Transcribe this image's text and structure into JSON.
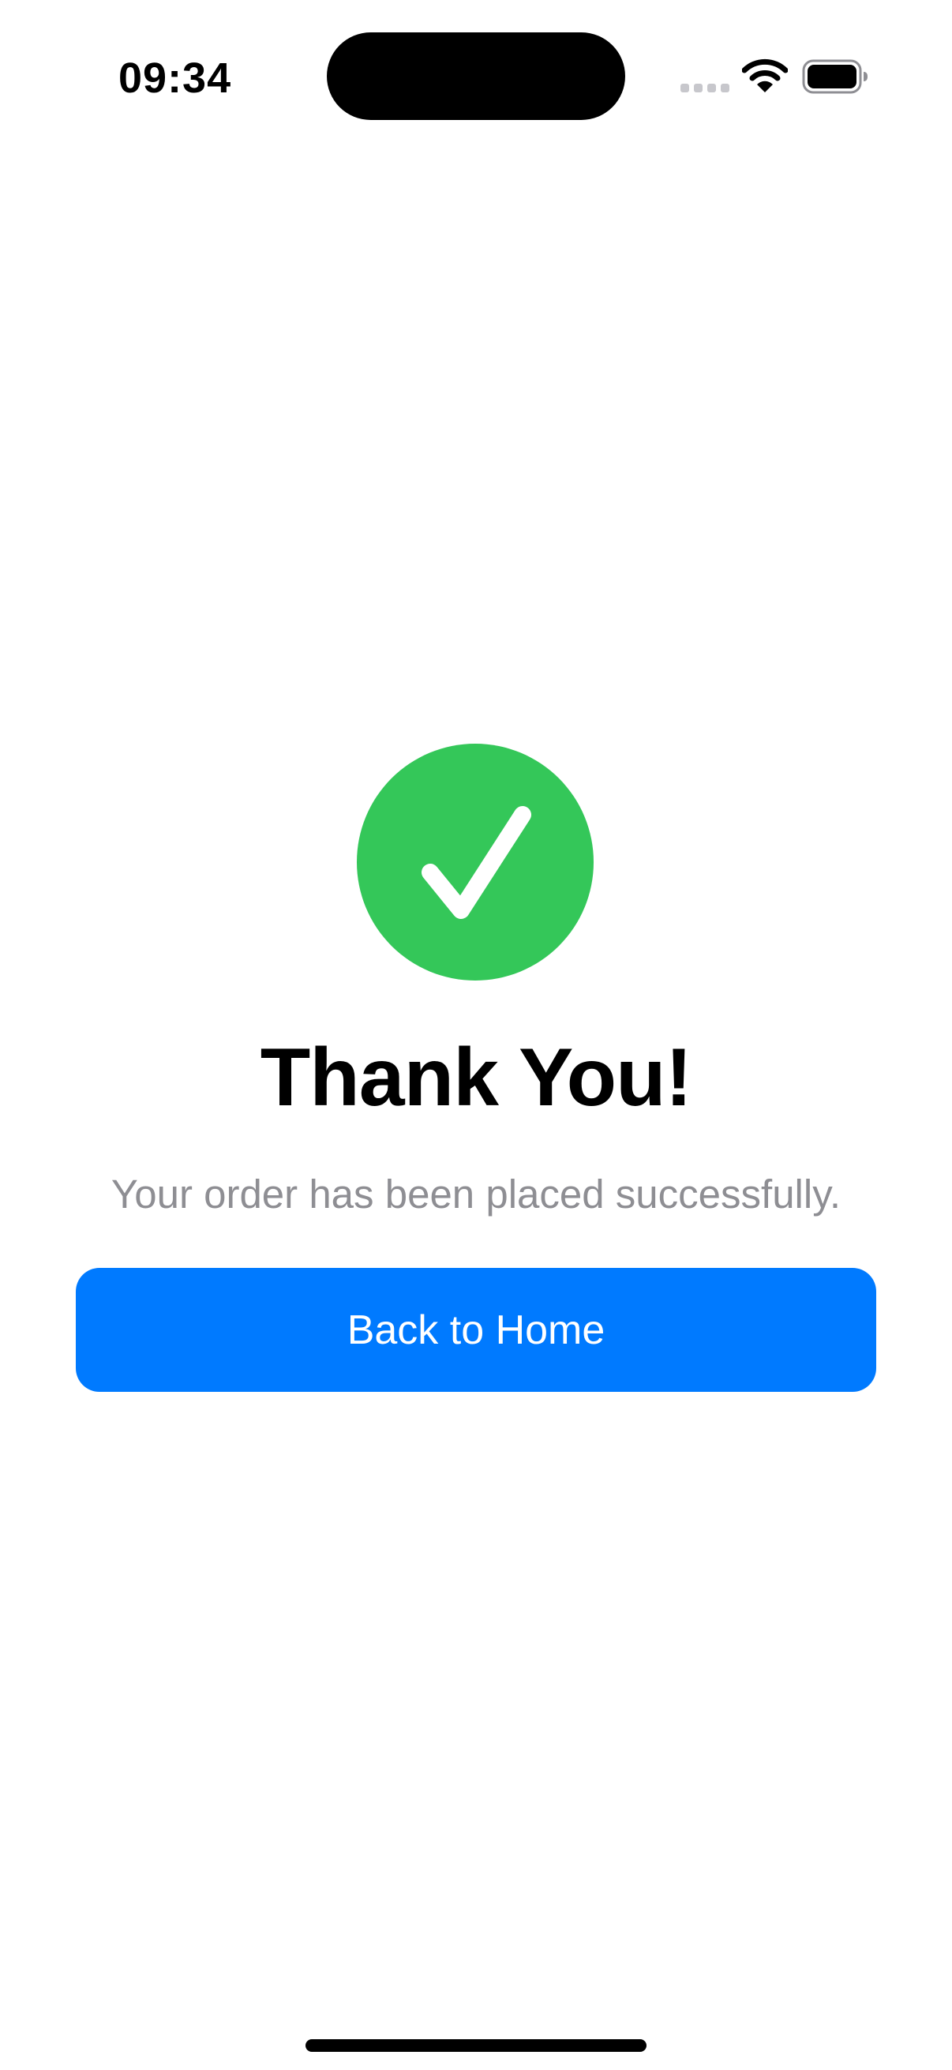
{
  "status_bar": {
    "time": "09:34",
    "icons": [
      "cellular-signal-icon",
      "wifi-icon",
      "battery-icon"
    ]
  },
  "confirmation": {
    "icon": "checkmark-circle-icon",
    "icon_color": "#34c759",
    "title": "Thank You!",
    "message": "Your order has been placed successfully."
  },
  "actions": {
    "back_home_label": "Back to Home",
    "button_color": "#007aff"
  }
}
